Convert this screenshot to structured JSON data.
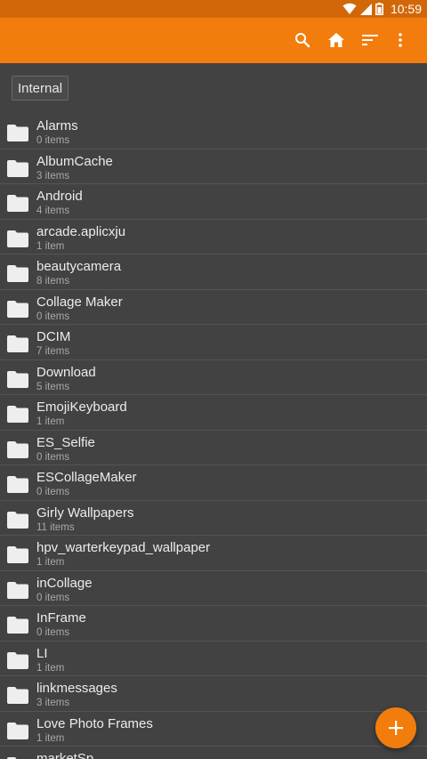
{
  "status_bar": {
    "time": "10:59",
    "icons": [
      "wifi-icon",
      "signal-icon",
      "battery-icon"
    ]
  },
  "toolbar": {
    "icons": [
      "search-icon",
      "home-icon",
      "sort-icon",
      "more-vert-icon"
    ],
    "background_color": "#f27d0c"
  },
  "path": {
    "label": "Internal"
  },
  "folders": [
    {
      "name": "Alarms",
      "count": "0 items"
    },
    {
      "name": "AlbumCache",
      "count": "3 items"
    },
    {
      "name": "Android",
      "count": "4 items"
    },
    {
      "name": "arcade.aplicxju",
      "count": "1 item"
    },
    {
      "name": "beautycamera",
      "count": "8 items"
    },
    {
      "name": "Collage Maker",
      "count": "0 items"
    },
    {
      "name": "DCIM",
      "count": "7 items"
    },
    {
      "name": "Download",
      "count": "5 items"
    },
    {
      "name": "EmojiKeyboard",
      "count": "1 item"
    },
    {
      "name": "ES_Selfie",
      "count": "0 items"
    },
    {
      "name": "ESCollageMaker",
      "count": "0 items"
    },
    {
      "name": "Girly Wallpapers",
      "count": "11 items"
    },
    {
      "name": "hpv_warterkeypad_wallpaper",
      "count": "1 item"
    },
    {
      "name": "inCollage",
      "count": "0 items"
    },
    {
      "name": "InFrame",
      "count": "0 items"
    },
    {
      "name": "LI",
      "count": "1 item"
    },
    {
      "name": "linkmessages",
      "count": "3 items"
    },
    {
      "name": "Love Photo Frames",
      "count": "1 item"
    },
    {
      "name": "marketSp",
      "count": ""
    }
  ],
  "fab": {
    "icon": "add-icon",
    "color": "#f27d0c"
  }
}
